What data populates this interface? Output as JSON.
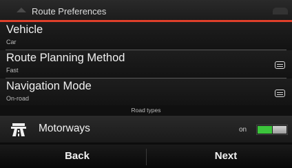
{
  "header": {
    "title": "Route Preferences"
  },
  "rows": [
    {
      "title": "Vehicle",
      "subtitle": "Car",
      "has_list_icon": false
    },
    {
      "title": "Route Planning Method",
      "subtitle": "Fast",
      "has_list_icon": true
    },
    {
      "title": "Navigation Mode",
      "subtitle": "On-road",
      "has_list_icon": true
    }
  ],
  "section": {
    "label": "Road types"
  },
  "motorways": {
    "label": "Motorways",
    "state": "on",
    "toggle_on": true,
    "icon": "motorway-icon",
    "toggle_color": "#3cc43c"
  },
  "footer": {
    "back_label": "Back",
    "next_label": "Next"
  },
  "colors": {
    "accent": "#e0402a",
    "toggle_on": "#3cc43c"
  }
}
